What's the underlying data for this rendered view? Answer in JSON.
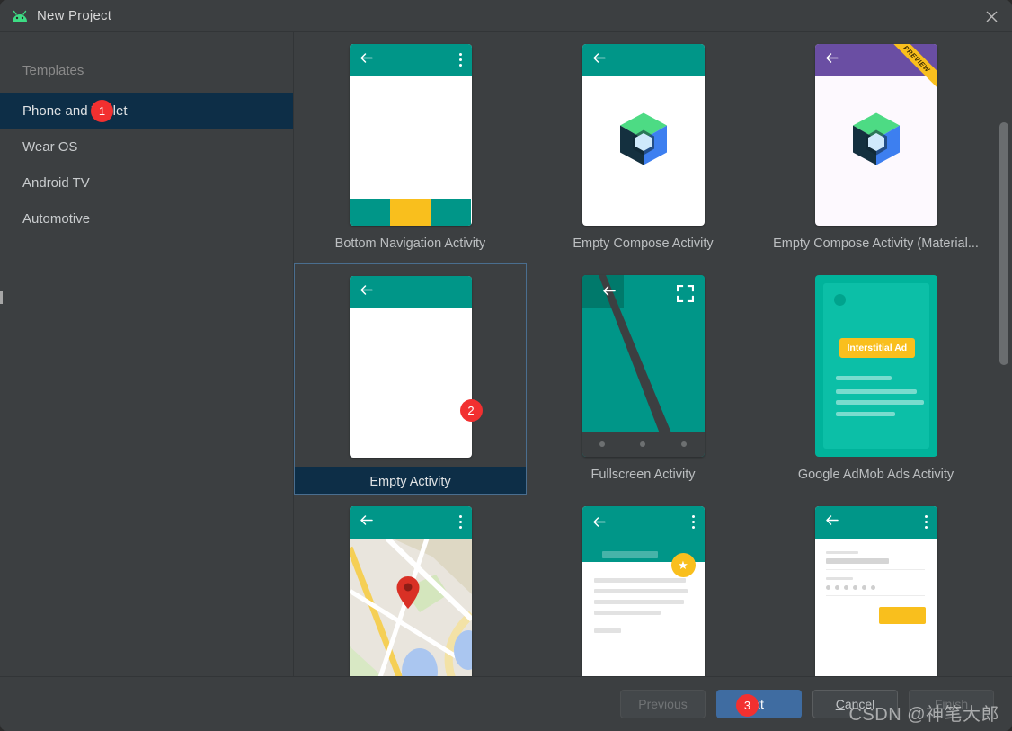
{
  "window": {
    "title": "New Project",
    "app_icon": "android-robot-icon",
    "close_icon": "close-icon"
  },
  "sidebar": {
    "header": "Templates",
    "items": [
      {
        "label": "Phone and Tablet",
        "selected": true
      },
      {
        "label": "Wear OS",
        "selected": false
      },
      {
        "label": "Android TV",
        "selected": false
      },
      {
        "label": "Automotive",
        "selected": false
      }
    ]
  },
  "gallery": {
    "templates": [
      {
        "label": "Bottom Navigation Activity",
        "thumb": "bottom-navigation",
        "selected": false
      },
      {
        "label": "Empty Compose Activity",
        "thumb": "compose",
        "selected": false
      },
      {
        "label": "Empty Compose Activity (Material...",
        "thumb": "compose-material3",
        "selected": false,
        "ribbon": "PREVIEW"
      },
      {
        "label": "Empty Activity",
        "thumb": "empty",
        "selected": true
      },
      {
        "label": "Fullscreen Activity",
        "thumb": "fullscreen",
        "selected": false
      },
      {
        "label": "Google AdMob Ads Activity",
        "thumb": "admob",
        "selected": false,
        "chip": "Interstitial Ad"
      },
      {
        "label": "",
        "thumb": "maps",
        "selected": false
      },
      {
        "label": "",
        "thumb": "list-detail",
        "selected": false
      },
      {
        "label": "",
        "thumb": "login",
        "selected": false
      }
    ]
  },
  "scrollbar": {
    "name": "vertical-scrollbar"
  },
  "footer": {
    "previous": "Previous",
    "next": "Next",
    "next_visible": "xt",
    "cancel_prefix": "C",
    "cancel_rest": "ancel",
    "finish": "Finish"
  },
  "badges": [
    {
      "number": "1",
      "target": "sidebar-item-phone-and-tablet"
    },
    {
      "number": "2",
      "target": "template-empty-activity"
    },
    {
      "number": "3",
      "target": "next-button"
    }
  ],
  "watermark": "CSDN @神笔大郎",
  "colors": {
    "dialog_bg": "#3c3f41",
    "selection": "#0d2e47",
    "accent_primary": "#3f6ca1",
    "badge_red": "#f23030",
    "material_teal": "#009688",
    "material_amber": "#f9bf1d",
    "compose_purple": "#6a4ea3"
  }
}
